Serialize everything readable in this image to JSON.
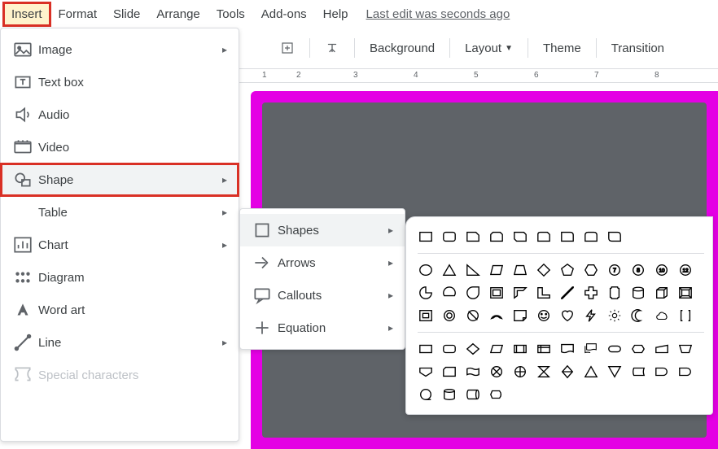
{
  "menubar": {
    "insert": "Insert",
    "format": "Format",
    "slide": "Slide",
    "arrange": "Arrange",
    "tools": "Tools",
    "addons": "Add-ons",
    "help": "Help",
    "status": "Last edit was seconds ago"
  },
  "toolbar": {
    "background": "Background",
    "layout": "Layout",
    "theme": "Theme",
    "transition": "Transition"
  },
  "ruler": {
    "t1": "1",
    "t2": "2",
    "t3": "3",
    "t4": "4",
    "t5": "5",
    "t6": "6",
    "t7": "7",
    "t8": "8"
  },
  "insertMenu": {
    "image": "Image",
    "textbox": "Text box",
    "audio": "Audio",
    "video": "Video",
    "shape": "Shape",
    "table": "Table",
    "chart": "Chart",
    "diagram": "Diagram",
    "wordart": "Word art",
    "line": "Line",
    "special": "Special characters"
  },
  "shapeSub": {
    "shapes": "Shapes",
    "arrows": "Arrows",
    "callouts": "Callouts",
    "equation": "Equation"
  }
}
